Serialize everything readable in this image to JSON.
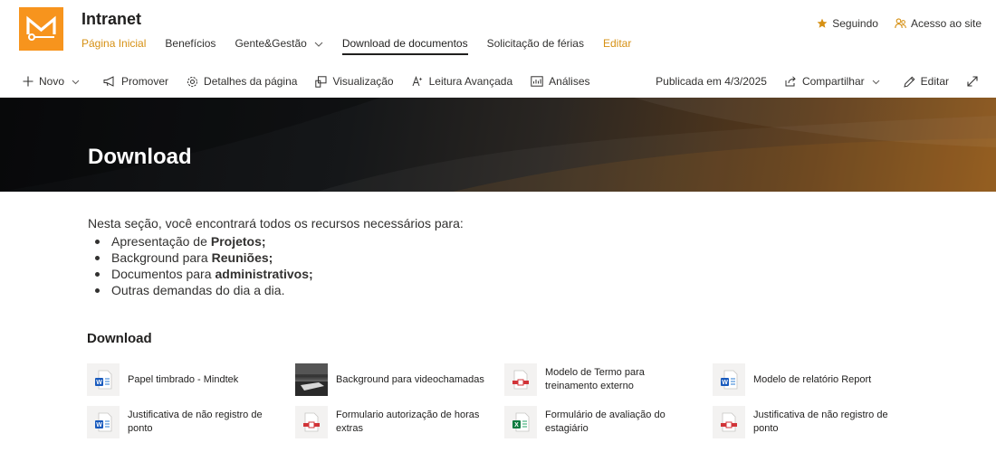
{
  "site": {
    "title": "Intranet",
    "logo_letter": "M",
    "brand_color": "#f7941d",
    "nav": [
      {
        "label": "Página Inicial"
      },
      {
        "label": "Benefícios"
      },
      {
        "label": "Gente&Gestão"
      },
      {
        "label": "Download de documentos"
      },
      {
        "label": "Solicitação de férias"
      },
      {
        "label": "Editar"
      }
    ],
    "following_label": "Seguindo",
    "site_access_label": "Acesso ao site"
  },
  "commandbar": {
    "new_label": "Novo",
    "promote_label": "Promover",
    "page_details_label": "Detalhes da página",
    "view_label": "Visualização",
    "immersive_reader_label": "Leitura Avançada",
    "analytics_label": "Análises",
    "published_label": "Publicada em 4/3/2025",
    "share_label": "Compartilhar",
    "edit_label": "Editar"
  },
  "banner": {
    "title": "Download"
  },
  "content": {
    "intro": "Nesta seção, você encontrará todos os recursos necessários para:",
    "bullets": [
      {
        "prefix": "Apresentação de",
        "bold": "Projetos;"
      },
      {
        "prefix": "Background para",
        "bold": "Reuniões;"
      },
      {
        "prefix": "Documentos para",
        "bold": "administrativos;"
      },
      {
        "prefix": "Outras demandas do dia a dia.",
        "bold": ""
      }
    ]
  },
  "files": {
    "section_title": "Download",
    "items": [
      {
        "name": "Papel timbrado - Mindtek",
        "icon": "word-icon"
      },
      {
        "name": "Background para videochamadas",
        "icon": "image-thumbnail"
      },
      {
        "name": "Modelo de Termo para treinamento externo",
        "icon": "pdf-icon"
      },
      {
        "name": "Modelo de relatório Report",
        "icon": "word-icon"
      },
      {
        "name": "Justificativa de não registro de ponto",
        "icon": "word-icon"
      },
      {
        "name": "Formulario autorização de horas extras",
        "icon": "pdf-icon"
      },
      {
        "name": "Formulário de avaliação do estagiário",
        "icon": "excel-icon"
      },
      {
        "name": "Justificativa de não registro de ponto",
        "icon": "pdf-icon"
      }
    ]
  }
}
